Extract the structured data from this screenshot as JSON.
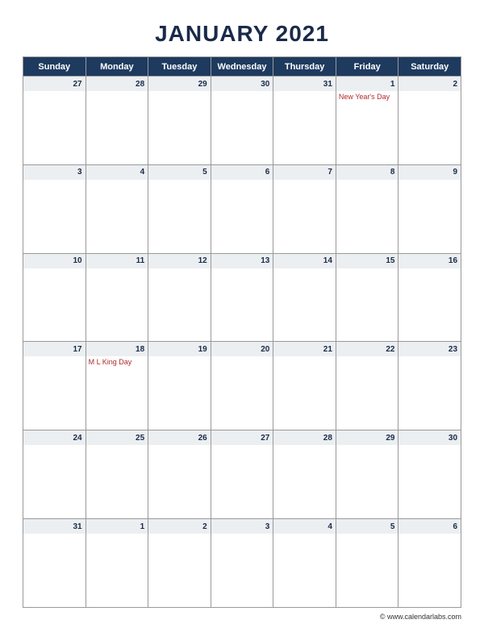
{
  "title": "JANUARY 2021",
  "day_headers": [
    "Sunday",
    "Monday",
    "Tuesday",
    "Wednesday",
    "Thursday",
    "Friday",
    "Saturday"
  ],
  "weeks": [
    [
      {
        "num": "27",
        "event": ""
      },
      {
        "num": "28",
        "event": ""
      },
      {
        "num": "29",
        "event": ""
      },
      {
        "num": "30",
        "event": ""
      },
      {
        "num": "31",
        "event": ""
      },
      {
        "num": "1",
        "event": "New Year's Day"
      },
      {
        "num": "2",
        "event": ""
      }
    ],
    [
      {
        "num": "3",
        "event": ""
      },
      {
        "num": "4",
        "event": ""
      },
      {
        "num": "5",
        "event": ""
      },
      {
        "num": "6",
        "event": ""
      },
      {
        "num": "7",
        "event": ""
      },
      {
        "num": "8",
        "event": ""
      },
      {
        "num": "9",
        "event": ""
      }
    ],
    [
      {
        "num": "10",
        "event": ""
      },
      {
        "num": "11",
        "event": ""
      },
      {
        "num": "12",
        "event": ""
      },
      {
        "num": "13",
        "event": ""
      },
      {
        "num": "14",
        "event": ""
      },
      {
        "num": "15",
        "event": ""
      },
      {
        "num": "16",
        "event": ""
      }
    ],
    [
      {
        "num": "17",
        "event": ""
      },
      {
        "num": "18",
        "event": "M L King Day"
      },
      {
        "num": "19",
        "event": ""
      },
      {
        "num": "20",
        "event": ""
      },
      {
        "num": "21",
        "event": ""
      },
      {
        "num": "22",
        "event": ""
      },
      {
        "num": "23",
        "event": ""
      }
    ],
    [
      {
        "num": "24",
        "event": ""
      },
      {
        "num": "25",
        "event": ""
      },
      {
        "num": "26",
        "event": ""
      },
      {
        "num": "27",
        "event": ""
      },
      {
        "num": "28",
        "event": ""
      },
      {
        "num": "29",
        "event": ""
      },
      {
        "num": "30",
        "event": ""
      }
    ],
    [
      {
        "num": "31",
        "event": ""
      },
      {
        "num": "1",
        "event": ""
      },
      {
        "num": "2",
        "event": ""
      },
      {
        "num": "3",
        "event": ""
      },
      {
        "num": "4",
        "event": ""
      },
      {
        "num": "5",
        "event": ""
      },
      {
        "num": "6",
        "event": ""
      }
    ]
  ],
  "footer": "© www.calendarlabs.com"
}
